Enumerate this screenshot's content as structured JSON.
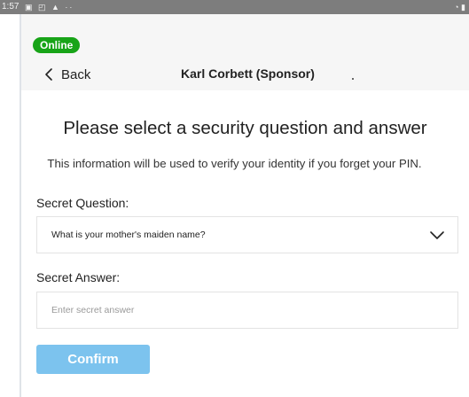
{
  "status_bar": {
    "time": "1:57",
    "left_icons": "▣ ◰ ▲ ··",
    "right_icons": "◔ ▮"
  },
  "header": {
    "online_badge": "Online",
    "back_label": "Back",
    "title": "Karl Corbett (Sponsor)"
  },
  "page": {
    "heading": "Please select a security question and answer",
    "subtitle": "This information will be used to verify your identity if you forget your PIN."
  },
  "form": {
    "question_label": "Secret Question:",
    "question_value": "What is your mother's maiden name?",
    "answer_label": "Secret Answer:",
    "answer_placeholder": "Enter secret answer",
    "answer_value": "",
    "confirm_label": "Confirm"
  },
  "colors": {
    "online_green": "#18a418",
    "confirm_blue": "#7cc3ee",
    "status_bar_gray": "#7d7d7d",
    "header_bg": "#f6f6f6"
  },
  "icons": {
    "back": "chevron-left-icon",
    "dropdown": "chevron-down-icon"
  }
}
